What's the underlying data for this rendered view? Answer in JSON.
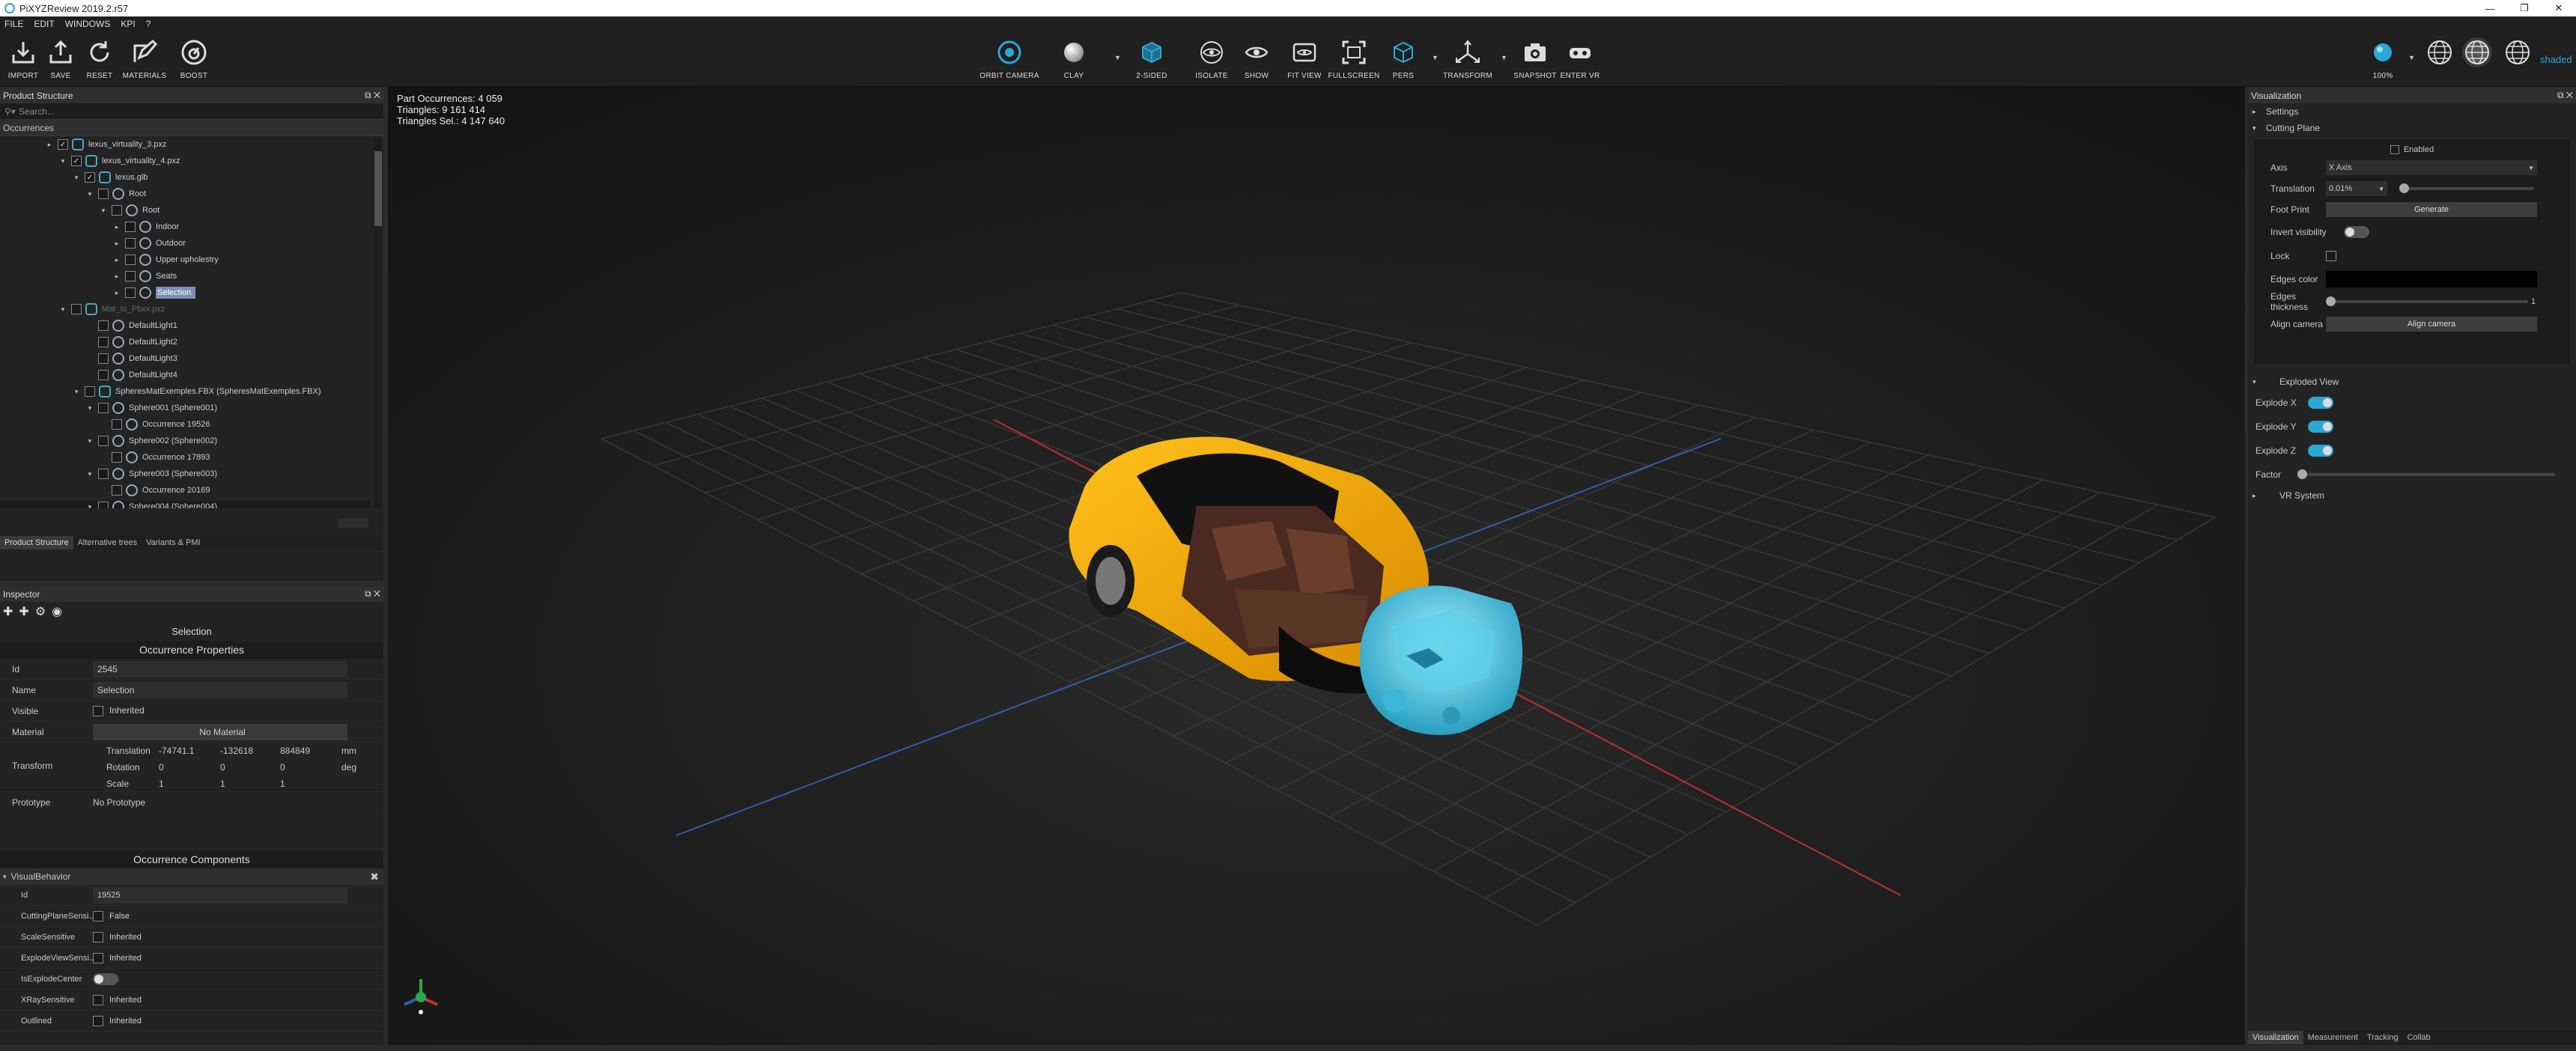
{
  "window": {
    "title": "PiXYZReview 2019.2.r57"
  },
  "menu": [
    "FILE",
    "EDIT",
    "WINDOWS",
    "KPI",
    "?"
  ],
  "toolbar": {
    "left": [
      "IMPORT",
      "SAVE",
      "RESET",
      "MATERIALS",
      "BOOST"
    ],
    "center": [
      "ORBIT CAMERA",
      "CLAY",
      "2-SIDED",
      "ISOLATE",
      "SHOW",
      "FIT VIEW",
      "FULLSCREEN",
      "PERS",
      "TRANSFORM",
      "SNAPSHOT",
      "ENTER VR"
    ],
    "zoom": "100%",
    "shade_label": "shaded"
  },
  "product_structure": {
    "title": "Product Structure",
    "search_placeholder": "Search...",
    "header": "Occurrences",
    "rows": [
      {
        "label": "lexus_virtuality_3.pxz",
        "indent": 0,
        "arrow": "▸",
        "checked": true
      },
      {
        "label": "lexus_virtuality_4.pxz",
        "indent": 1,
        "arrow": "▾",
        "checked": true
      },
      {
        "label": "lexus.glb",
        "indent": 2,
        "arrow": "▾",
        "checked": true
      },
      {
        "label": "Root",
        "indent": 3,
        "arrow": "▾",
        "checked": false
      },
      {
        "label": "Root",
        "indent": 4,
        "arrow": "▾",
        "checked": false
      },
      {
        "label": "Indoor",
        "indent": 5,
        "arrow": "▸",
        "checked": false
      },
      {
        "label": "Outdoor",
        "indent": 5,
        "arrow": "▸",
        "checked": false
      },
      {
        "label": "Upper upholestry",
        "indent": 5,
        "arrow": "▸",
        "checked": false
      },
      {
        "label": "Seats",
        "indent": 5,
        "arrow": "▸",
        "checked": false
      },
      {
        "label": "Selection",
        "indent": 5,
        "arrow": "▸",
        "checked": false,
        "selected": true
      },
      {
        "label": "Mat_to_Pbxx.pxz",
        "indent": 1,
        "arrow": "▾",
        "checked": false,
        "dim": true
      },
      {
        "label": "DefaultLight1",
        "indent": 3,
        "arrow": "",
        "checked": false
      },
      {
        "label": "DefaultLight2",
        "indent": 3,
        "arrow": "",
        "checked": false
      },
      {
        "label": "DefaultLight3",
        "indent": 3,
        "arrow": "",
        "checked": false
      },
      {
        "label": "DefaultLight4",
        "indent": 3,
        "arrow": "",
        "checked": false
      },
      {
        "label": "SpheresMatExemples.FBX (SpheresMatExemples.FBX)",
        "indent": 2,
        "arrow": "▾",
        "checked": false
      },
      {
        "label": "Sphere001 (Sphere001)",
        "indent": 3,
        "arrow": "▾",
        "checked": false
      },
      {
        "label": "Occurrence 19526",
        "indent": 4,
        "arrow": "",
        "checked": false
      },
      {
        "label": "Sphere002 (Sphere002)",
        "indent": 3,
        "arrow": "▾",
        "checked": false
      },
      {
        "label": "Occurrence 17893",
        "indent": 4,
        "arrow": "",
        "checked": false
      },
      {
        "label": "Sphere003 (Sphere003)",
        "indent": 3,
        "arrow": "▾",
        "checked": false
      },
      {
        "label": "Occurrence 20169",
        "indent": 4,
        "arrow": "",
        "checked": false
      },
      {
        "label": "Sphere004 (Sphere004)",
        "indent": 3,
        "arrow": "▾",
        "checked": false
      }
    ],
    "tabs": [
      "Product Structure",
      "Alternative trees",
      "Variants & PMI"
    ]
  },
  "inspector": {
    "title": "Inspector",
    "selection": "Selection",
    "occ_props_title": "Occurrence Properties",
    "id_label": "Id",
    "id_value": "2545",
    "name_label": "Name",
    "name_value": "Selection",
    "visible_label": "Visible",
    "visible_value": "Inherited",
    "material_label": "Material",
    "material_value": "No Material",
    "transform_label": "Transform",
    "translation_label": "Translation",
    "translation": [
      "-74741.1",
      "-132618",
      "884849"
    ],
    "translation_unit": "mm",
    "rotation_label": "Rotation",
    "rotation": [
      "0",
      "0",
      "0"
    ],
    "rotation_unit": "deg",
    "scale_label": "Scale",
    "scale": [
      "1",
      "1",
      "1"
    ],
    "prototype_label": "Prototype",
    "prototype_value": "No Prototype",
    "occ_comp_title": "Occurrence Components",
    "vb_title": "VisualBehavior",
    "vb": [
      {
        "k": "Id",
        "v": "19525",
        "type": "text"
      },
      {
        "k": "CuttingPlaneSensi...",
        "v": "False",
        "type": "check"
      },
      {
        "k": "ScaleSensitive",
        "v": "Inherited",
        "type": "check"
      },
      {
        "k": "ExplodeViewSensi...",
        "v": "Inherited",
        "type": "check"
      },
      {
        "k": "IsExplodeCenter",
        "v": "",
        "type": "toggle"
      },
      {
        "k": "XRaySensitive",
        "v": "Inherited",
        "type": "check"
      },
      {
        "k": "Outlined",
        "v": "Inherited",
        "type": "check"
      }
    ]
  },
  "viewport": {
    "stats": [
      "Part Occurrences: 4 059",
      "Triangles: 9 161 414",
      "Triangles Sel.: 4 147 640"
    ]
  },
  "visualization": {
    "title": "Visualization",
    "settings": "Settings",
    "cutting_plane": "Cutting Plane",
    "enabled": "Enabled",
    "axis_label": "Axis",
    "axis_value": "X Axis",
    "translation_label": "Translation",
    "translation_value": "0.01%",
    "footprint_label": "Foot Print",
    "generate": "Generate",
    "invert_label": "Invert visibility",
    "lock_label": "Lock",
    "edges_color_label": "Edges color",
    "edges_thickness_label": "Edges thickness",
    "edges_thickness_value": "1",
    "align_camera_label": "Align camera",
    "align_camera_btn": "Align camera",
    "exploded_view": "Exploded View",
    "explode_x": "Explode X",
    "explode_y": "Explode Y",
    "explode_z": "Explode Z",
    "factor": "Factor",
    "vr_system": "VR System",
    "tabs": [
      "Visualization",
      "Measurement",
      "Tracking",
      "Collab"
    ]
  }
}
